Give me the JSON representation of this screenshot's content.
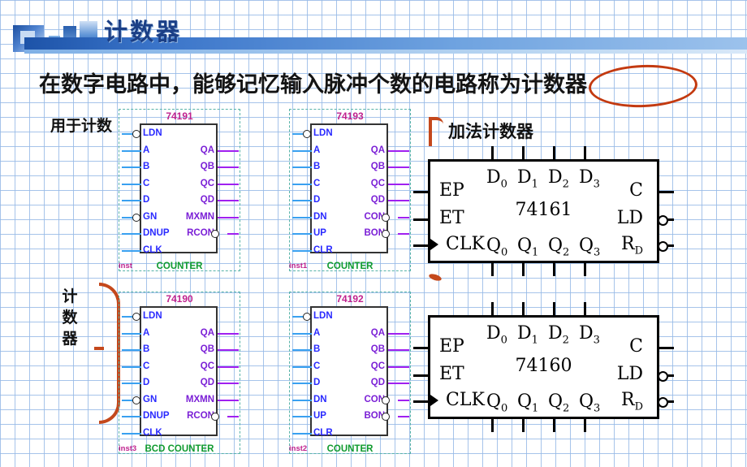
{
  "slide": {
    "title": "计数器",
    "lead_text": "在数字电路中，能够记忆输入脉冲个数的电路称为计数器",
    "highlighted_term": "计数器"
  },
  "annotations": {
    "used_for": "用于计数",
    "group_label": "计数器",
    "adder_label": "加法计数器",
    "colors": {
      "accent_orange": "#c4481c",
      "title_blue": "#1b3f86",
      "banner_blue": "#1d53a8",
      "grid_blue": "#96b9e6"
    }
  },
  "eda_symbols": [
    {
      "part": "74191",
      "instance": "inst",
      "function": "COUNTER",
      "left_pins": [
        {
          "name": "LDN",
          "inverted": true
        },
        {
          "name": "A",
          "inverted": false
        },
        {
          "name": "B",
          "inverted": false
        },
        {
          "name": "C",
          "inverted": false
        },
        {
          "name": "D",
          "inverted": false
        },
        {
          "name": "GN",
          "inverted": true
        },
        {
          "name": "DNUP",
          "inverted": false
        },
        {
          "name": "CLK",
          "inverted": false
        }
      ],
      "right_pins": [
        {
          "name": "QA",
          "inverted": false
        },
        {
          "name": "QB",
          "inverted": false
        },
        {
          "name": "QC",
          "inverted": false
        },
        {
          "name": "QD",
          "inverted": false
        },
        {
          "name": "MXMN",
          "inverted": false
        },
        {
          "name": "RCON",
          "inverted": true
        }
      ]
    },
    {
      "part": "74193",
      "instance": "inst1",
      "function": "COUNTER",
      "left_pins": [
        {
          "name": "LDN",
          "inverted": true
        },
        {
          "name": "A",
          "inverted": false
        },
        {
          "name": "B",
          "inverted": false
        },
        {
          "name": "C",
          "inverted": false
        },
        {
          "name": "D",
          "inverted": false
        },
        {
          "name": "DN",
          "inverted": false
        },
        {
          "name": "UP",
          "inverted": false
        },
        {
          "name": "CLR",
          "inverted": false
        }
      ],
      "right_pins": [
        {
          "name": "QA",
          "inverted": false
        },
        {
          "name": "QB",
          "inverted": false
        },
        {
          "name": "QC",
          "inverted": false
        },
        {
          "name": "QD",
          "inverted": false
        },
        {
          "name": "CON",
          "inverted": true
        },
        {
          "name": "BON",
          "inverted": true
        }
      ]
    },
    {
      "part": "74190",
      "instance": "inst3",
      "function": "BCD COUNTER",
      "left_pins": [
        {
          "name": "LDN",
          "inverted": true
        },
        {
          "name": "A",
          "inverted": false
        },
        {
          "name": "B",
          "inverted": false
        },
        {
          "name": "C",
          "inverted": false
        },
        {
          "name": "D",
          "inverted": false
        },
        {
          "name": "GN",
          "inverted": true
        },
        {
          "name": "DNUP",
          "inverted": false
        },
        {
          "name": "CLK",
          "inverted": false
        }
      ],
      "right_pins": [
        {
          "name": "QA",
          "inverted": false
        },
        {
          "name": "QB",
          "inverted": false
        },
        {
          "name": "QC",
          "inverted": false
        },
        {
          "name": "QD",
          "inverted": false
        },
        {
          "name": "MXMN",
          "inverted": false
        },
        {
          "name": "RCON",
          "inverted": true
        }
      ]
    },
    {
      "part": "74192",
      "instance": "inst2",
      "function": "COUNTER",
      "left_pins": [
        {
          "name": "LDN",
          "inverted": true
        },
        {
          "name": "A",
          "inverted": false
        },
        {
          "name": "B",
          "inverted": false
        },
        {
          "name": "C",
          "inverted": false
        },
        {
          "name": "D",
          "inverted": false
        },
        {
          "name": "DN",
          "inverted": false
        },
        {
          "name": "UP",
          "inverted": false
        },
        {
          "name": "CLR",
          "inverted": false
        }
      ],
      "right_pins": [
        {
          "name": "QA",
          "inverted": false
        },
        {
          "name": "QB",
          "inverted": false
        },
        {
          "name": "QC",
          "inverted": false
        },
        {
          "name": "QD",
          "inverted": false
        },
        {
          "name": "CON",
          "inverted": true
        },
        {
          "name": "BON",
          "inverted": true
        }
      ]
    }
  ],
  "textbook_symbols": [
    {
      "part": "74161",
      "top_pins": [
        "D",
        "D",
        "D",
        "D"
      ],
      "top_subs": [
        "0",
        "1",
        "2",
        "3"
      ],
      "bottom_pins": [
        "Q",
        "Q",
        "Q",
        "Q"
      ],
      "bottom_subs": [
        "0",
        "1",
        "2",
        "3"
      ],
      "left_pins": [
        "EP",
        "ET",
        "CLK"
      ],
      "right_pins": [
        "C",
        "LD",
        "R"
      ],
      "right_subs": [
        "",
        "",
        "D"
      ],
      "clk_edge_triangle": true,
      "right_bubbles": [
        false,
        true,
        true
      ]
    },
    {
      "part": "74160",
      "top_pins": [
        "D",
        "D",
        "D",
        "D"
      ],
      "top_subs": [
        "0",
        "1",
        "2",
        "3"
      ],
      "bottom_pins": [
        "Q",
        "Q",
        "Q",
        "Q"
      ],
      "bottom_subs": [
        "0",
        "1",
        "2",
        "3"
      ],
      "left_pins": [
        "EP",
        "ET",
        "CLK"
      ],
      "right_pins": [
        "C",
        "LD",
        "R"
      ],
      "right_subs": [
        "",
        "",
        "D"
      ],
      "clk_edge_triangle": true,
      "right_bubbles": [
        false,
        true,
        true
      ]
    }
  ]
}
